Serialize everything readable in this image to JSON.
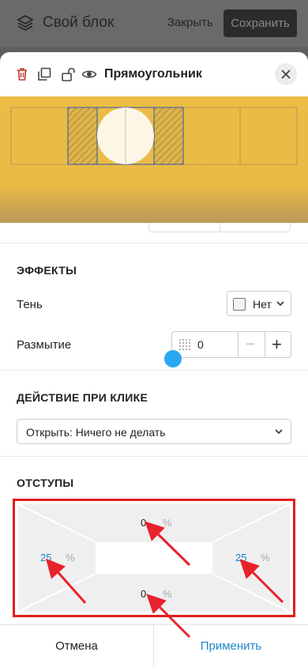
{
  "app_bar": {
    "title": "Свой блок",
    "close_label": "Закрыть",
    "save_label": "Сохранить"
  },
  "sheet": {
    "title": "Прямоугольник",
    "header_icons": [
      "trash-icon",
      "copy-icon",
      "unlock-icon",
      "eye-icon"
    ]
  },
  "effects": {
    "title": "ЭФФЕКТЫ",
    "shadow_label": "Тень",
    "shadow_value": "Нет",
    "blur_label": "Размытие",
    "blur_value": "0",
    "minus": "−",
    "plus": "+"
  },
  "click_action": {
    "title": "ДЕЙСТВИЕ ПРИ КЛИКЕ",
    "selected": "Открыть: Ничего не делать"
  },
  "paddings": {
    "title": "ОТСТУПЫ",
    "top": "0",
    "bottom": "0",
    "left": "25",
    "right": "25",
    "unit": "%"
  },
  "footer": {
    "cancel_label": "Отмена",
    "apply_label": "Применить"
  },
  "colors": {
    "preview_bg": "#ebbd45",
    "accent_blue": "#1e88c9",
    "highlight_red": "#e01d1d"
  }
}
